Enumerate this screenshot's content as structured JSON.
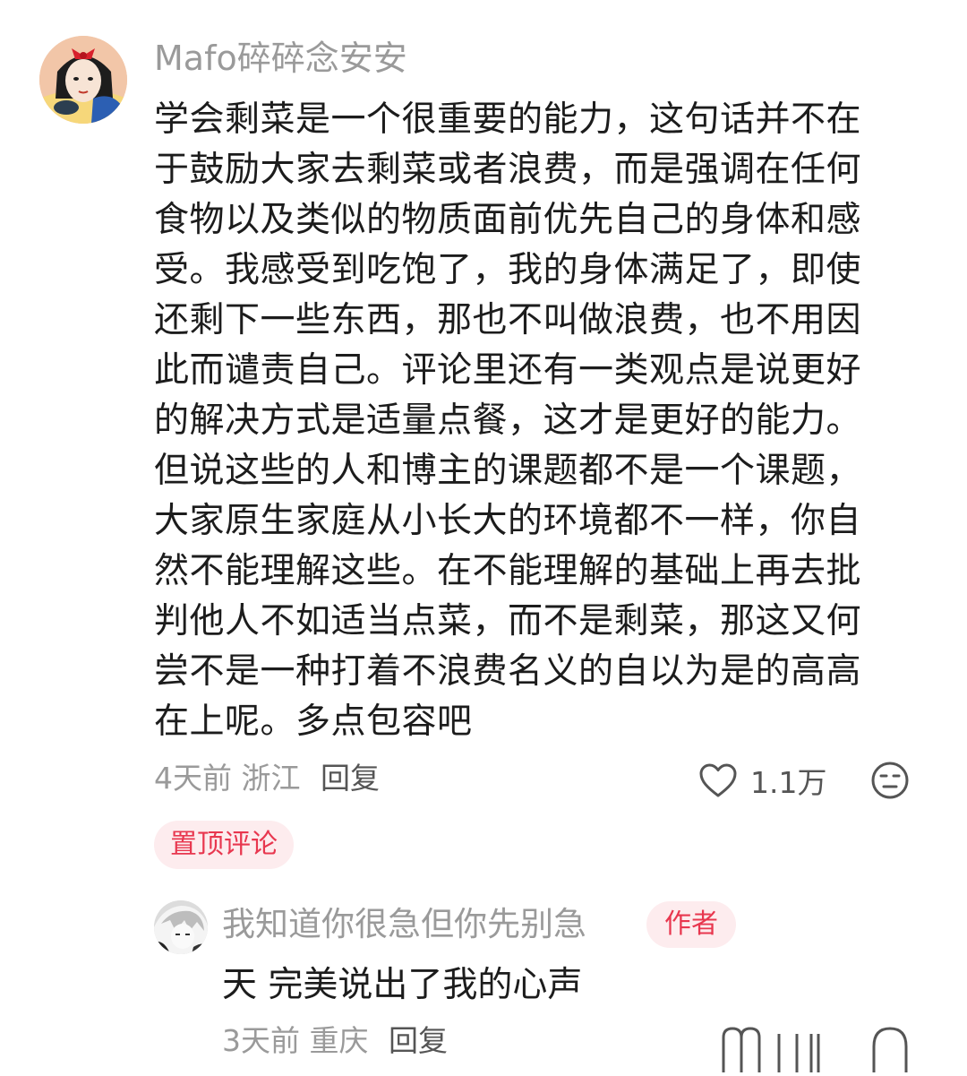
{
  "comment": {
    "username": "Mafo碎碎念安安",
    "avatar_icon": "cartoon-princess-avatar",
    "body_lines": [
      "学会剩菜是一个很重要的能力，这句话并不在",
      "于鼓励大家去剩菜或者浪费，而是强调在任何",
      "食物以及类似的物质面前优先自己的身体和感",
      "受。我感受到吃饱了，我的身体满足了，即使",
      "还剩下一些东西，那也不叫做浪费，也不用因",
      "此而谴责自己。评论里还有一类观点是说更好",
      "的解决方式是适量点餐，这才是更好的能力。",
      "但说这些的人和博主的课题都不是一个课题，",
      "大家原生家庭从小长大的环境都不一样，你自",
      "然不能理解这些。在不能理解的基础上再去批",
      "判他人不如适当点菜，而不是剩菜，那这又何",
      "尝不是一种打着不浪费名义的自以为是的高高",
      "在上呢。多点包容吧"
    ],
    "time": "4天前",
    "location": "浙江",
    "reply_label": "回复",
    "like_count": "1.1万",
    "like_icon": "heart-outline-icon",
    "dislike_icon": "neutral-face-icon",
    "pinned_label": "置顶评论"
  },
  "reply": {
    "username": "我知道你很急但你先别急",
    "avatar_icon": "anime-character-avatar",
    "author_badge": "作者",
    "body": "天 完美说出了我的心声",
    "time": "3天前",
    "location": "重庆",
    "reply_label": "回复"
  },
  "colors": {
    "text_primary": "#1c1c1c",
    "text_secondary": "#9a9a9a",
    "text_action": "#555555",
    "accent_red": "#e8374f",
    "badge_bg": "#fdecee"
  }
}
